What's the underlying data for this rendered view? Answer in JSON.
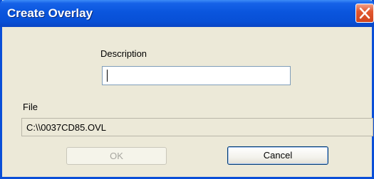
{
  "window": {
    "title": "Create Overlay"
  },
  "form": {
    "description_label": "Description",
    "description_value": "",
    "file_label": "File",
    "file_value": "C:\\\\0037CD85.OVL"
  },
  "buttons": {
    "ok_label": "OK",
    "ok_enabled": false,
    "cancel_label": "Cancel"
  },
  "icons": {
    "close": "close-icon"
  },
  "colors": {
    "titlebar": "#0a55dd",
    "window_bg": "#ece9d8",
    "close_button": "#e2572f",
    "disabled_text": "#a7a6a0"
  }
}
